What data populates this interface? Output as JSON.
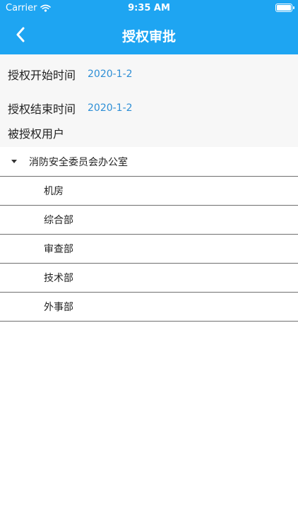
{
  "status_bar": {
    "carrier": "Carrier",
    "time": "9:35 AM"
  },
  "nav": {
    "title": "授权审批",
    "back_icon": "chevron-left-icon"
  },
  "form": {
    "start_label": "授权开始时间",
    "start_value": "2020-1-2",
    "end_label": "授权结束时间",
    "end_value": "2020-1-2",
    "user_label": "被授权用户"
  },
  "tree": {
    "root_label": "消防安全委员会办公室",
    "children": [
      {
        "label": "机房"
      },
      {
        "label": "综合部"
      },
      {
        "label": "审查部"
      },
      {
        "label": "技术部"
      },
      {
        "label": "外事部"
      }
    ]
  },
  "colors": {
    "header": "#1ea5f2",
    "date_value": "#2e8fd6",
    "form_background": "#f7f7f7",
    "divider": "#6f6f6f"
  }
}
